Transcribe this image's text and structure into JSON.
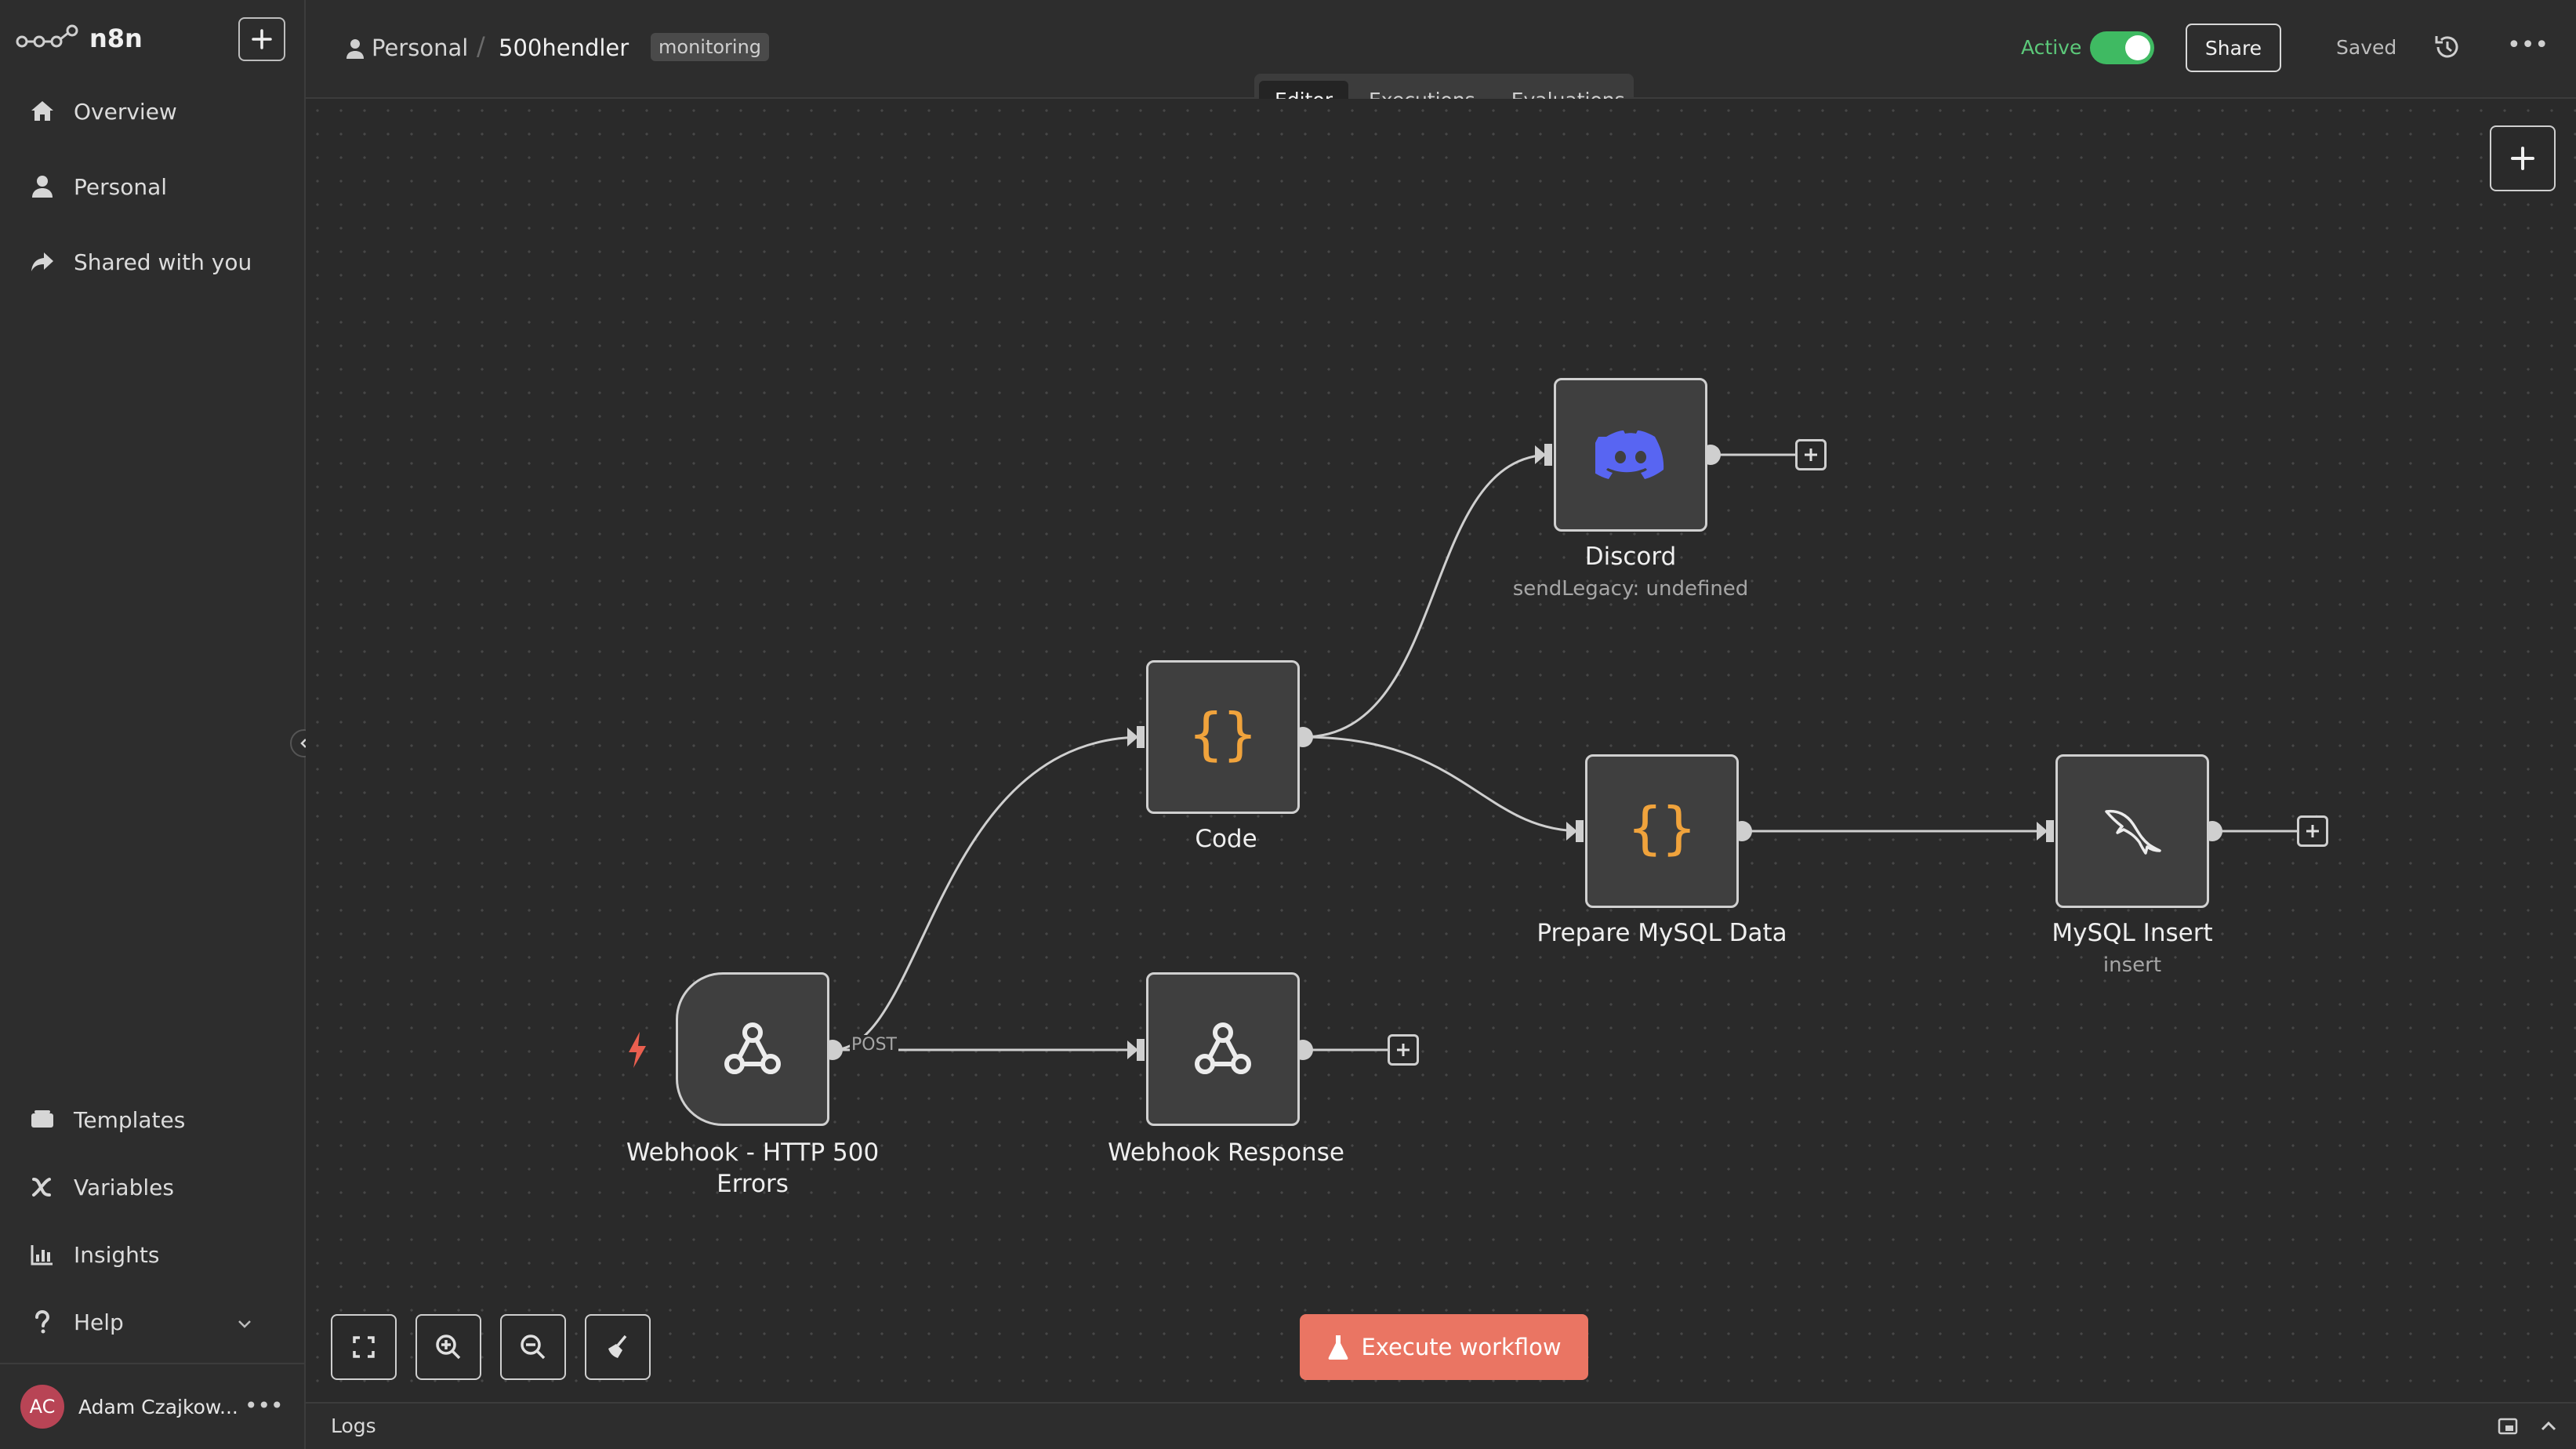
{
  "app": {
    "name": "n8n"
  },
  "sidebar": {
    "new_label": "+",
    "items": [
      {
        "label": "Overview",
        "icon": "home-icon"
      },
      {
        "label": "Personal",
        "icon": "user-icon"
      },
      {
        "label": "Shared with you",
        "icon": "share-icon"
      }
    ],
    "bottom_items": [
      {
        "label": "Templates",
        "icon": "templates-icon"
      },
      {
        "label": "Variables",
        "icon": "variables-icon"
      },
      {
        "label": "Insights",
        "icon": "insights-icon"
      },
      {
        "label": "Help",
        "icon": "help-icon"
      }
    ],
    "user": {
      "initials": "AC",
      "name": "Adam Czajkow...",
      "more": "•••"
    }
  },
  "header": {
    "breadcrumb_project": "Personal",
    "breadcrumb_sep": "/",
    "workflow_name": "500hendler",
    "tag": "monitoring",
    "active_label": "Active",
    "active": true,
    "share_label": "Share",
    "saved_label": "Saved",
    "more_label": "•••"
  },
  "tabs": [
    {
      "label": "Editor",
      "active": true
    },
    {
      "label": "Executions",
      "active": false
    },
    {
      "label": "Evaluations",
      "active": false
    }
  ],
  "nodes": {
    "webhook": {
      "label": "Webhook - HTTP 500 Errors",
      "icon": "webhook-icon"
    },
    "code": {
      "label": "Code",
      "icon": "code-braces-icon"
    },
    "discord": {
      "label": "Discord",
      "subtitle": "sendLegacy: undefined",
      "icon": "discord-icon"
    },
    "prepare": {
      "label": "Prepare MySQL Data",
      "icon": "code-braces-icon"
    },
    "mysql": {
      "label": "MySQL Insert",
      "subtitle": "insert",
      "icon": "mysql-dolphin-icon"
    },
    "response": {
      "label": "Webhook Response",
      "icon": "webhook-icon"
    }
  },
  "edge_labels": {
    "post": "POST"
  },
  "canvas": {
    "execute_label": "Execute workflow"
  },
  "logs": {
    "label": "Logs"
  },
  "colors": {
    "accent": "#ea7563",
    "active_green": "#3fba62",
    "code_orange": "#f0a33c",
    "discord_blue": "#5865f2"
  }
}
